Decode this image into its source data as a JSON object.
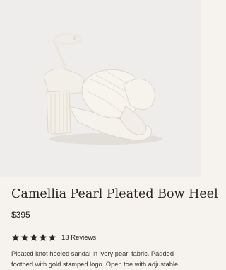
{
  "product": {
    "image_alt": "Camellia Pearl Pleated Bow Heel",
    "name": "Camellia Pearl Pleated Bow Heel",
    "price": "$395",
    "rating": {
      "stars": 5,
      "reviews_label": "13 Reviews"
    },
    "description": "Pleated knot heeled sandal in ivory pearl fabric. Padded footbed with gold stamped logo. Open toe with adjustable"
  },
  "colors": {
    "page_bg": "#f6f3ee",
    "image_bg": "#efedeb",
    "text": "#2b2520",
    "star": "#2b2520",
    "sandal_ivory": "#f4f1ea"
  }
}
